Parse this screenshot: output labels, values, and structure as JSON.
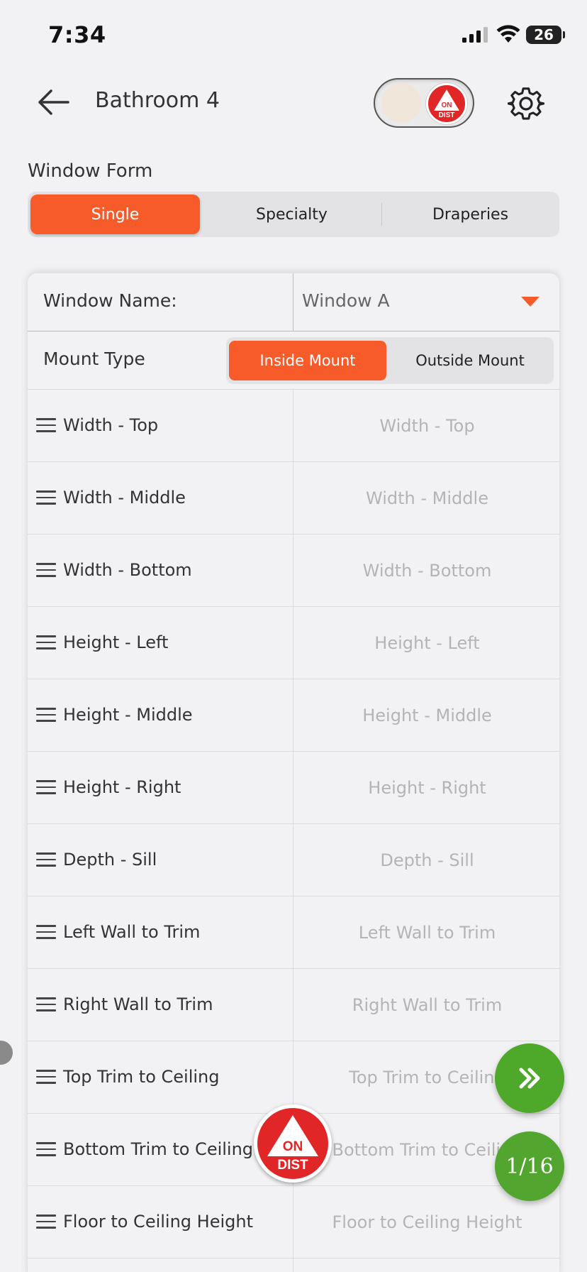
{
  "status_bar": {
    "time": "7:34",
    "battery": "26"
  },
  "header": {
    "title": "Bathroom 4",
    "toggle_badge": {
      "line1": "ON",
      "line2": "DIST"
    }
  },
  "window_form": {
    "label": "Window Form",
    "tabs": [
      {
        "label": "Single",
        "active": true
      },
      {
        "label": "Specialty",
        "active": false
      },
      {
        "label": "Draperies",
        "active": false
      }
    ]
  },
  "form": {
    "window_name_label": "Window Name:",
    "window_name_value": "Window A",
    "mount_type_label": "Mount Type",
    "mount_options": [
      {
        "label": "Inside Mount",
        "active": true
      },
      {
        "label": "Outside Mount",
        "active": false
      }
    ],
    "rows": [
      {
        "label": "Width - Top",
        "placeholder": "Width - Top"
      },
      {
        "label": "Width - Middle",
        "placeholder": "Width - Middle"
      },
      {
        "label": "Width - Bottom",
        "placeholder": "Width - Bottom"
      },
      {
        "label": "Height - Left",
        "placeholder": "Height - Left"
      },
      {
        "label": "Height - Middle",
        "placeholder": "Height - Middle"
      },
      {
        "label": "Height - Right",
        "placeholder": "Height - Right"
      },
      {
        "label": "Depth - Sill",
        "placeholder": "Depth - Sill"
      },
      {
        "label": "Left Wall to Trim",
        "placeholder": "Left Wall to Trim"
      },
      {
        "label": "Right Wall to Trim",
        "placeholder": "Right Wall to Trim"
      },
      {
        "label": "Top Trim to Ceiling",
        "placeholder": "Top Trim to Ceiling"
      },
      {
        "label": "Bottom Trim to Ceiling",
        "placeholder": "Bottom Trim to Ceiling"
      },
      {
        "label": "Floor to Ceiling Height",
        "placeholder": "Floor to Ceiling Height"
      },
      {
        "label": "",
        "placeholder": ""
      }
    ]
  },
  "floating": {
    "page_indicator": "1/16",
    "ondist_badge": {
      "line1": "ON",
      "line2": "DIST"
    }
  },
  "colors": {
    "accent": "#f85b2a",
    "fab_green": "#4ea82a",
    "badge_red": "#e02626"
  },
  "icons": [
    "back-arrow-icon",
    "gear-icon",
    "drag-handle-icon",
    "double-chevron-right-icon",
    "caret-down-icon"
  ]
}
